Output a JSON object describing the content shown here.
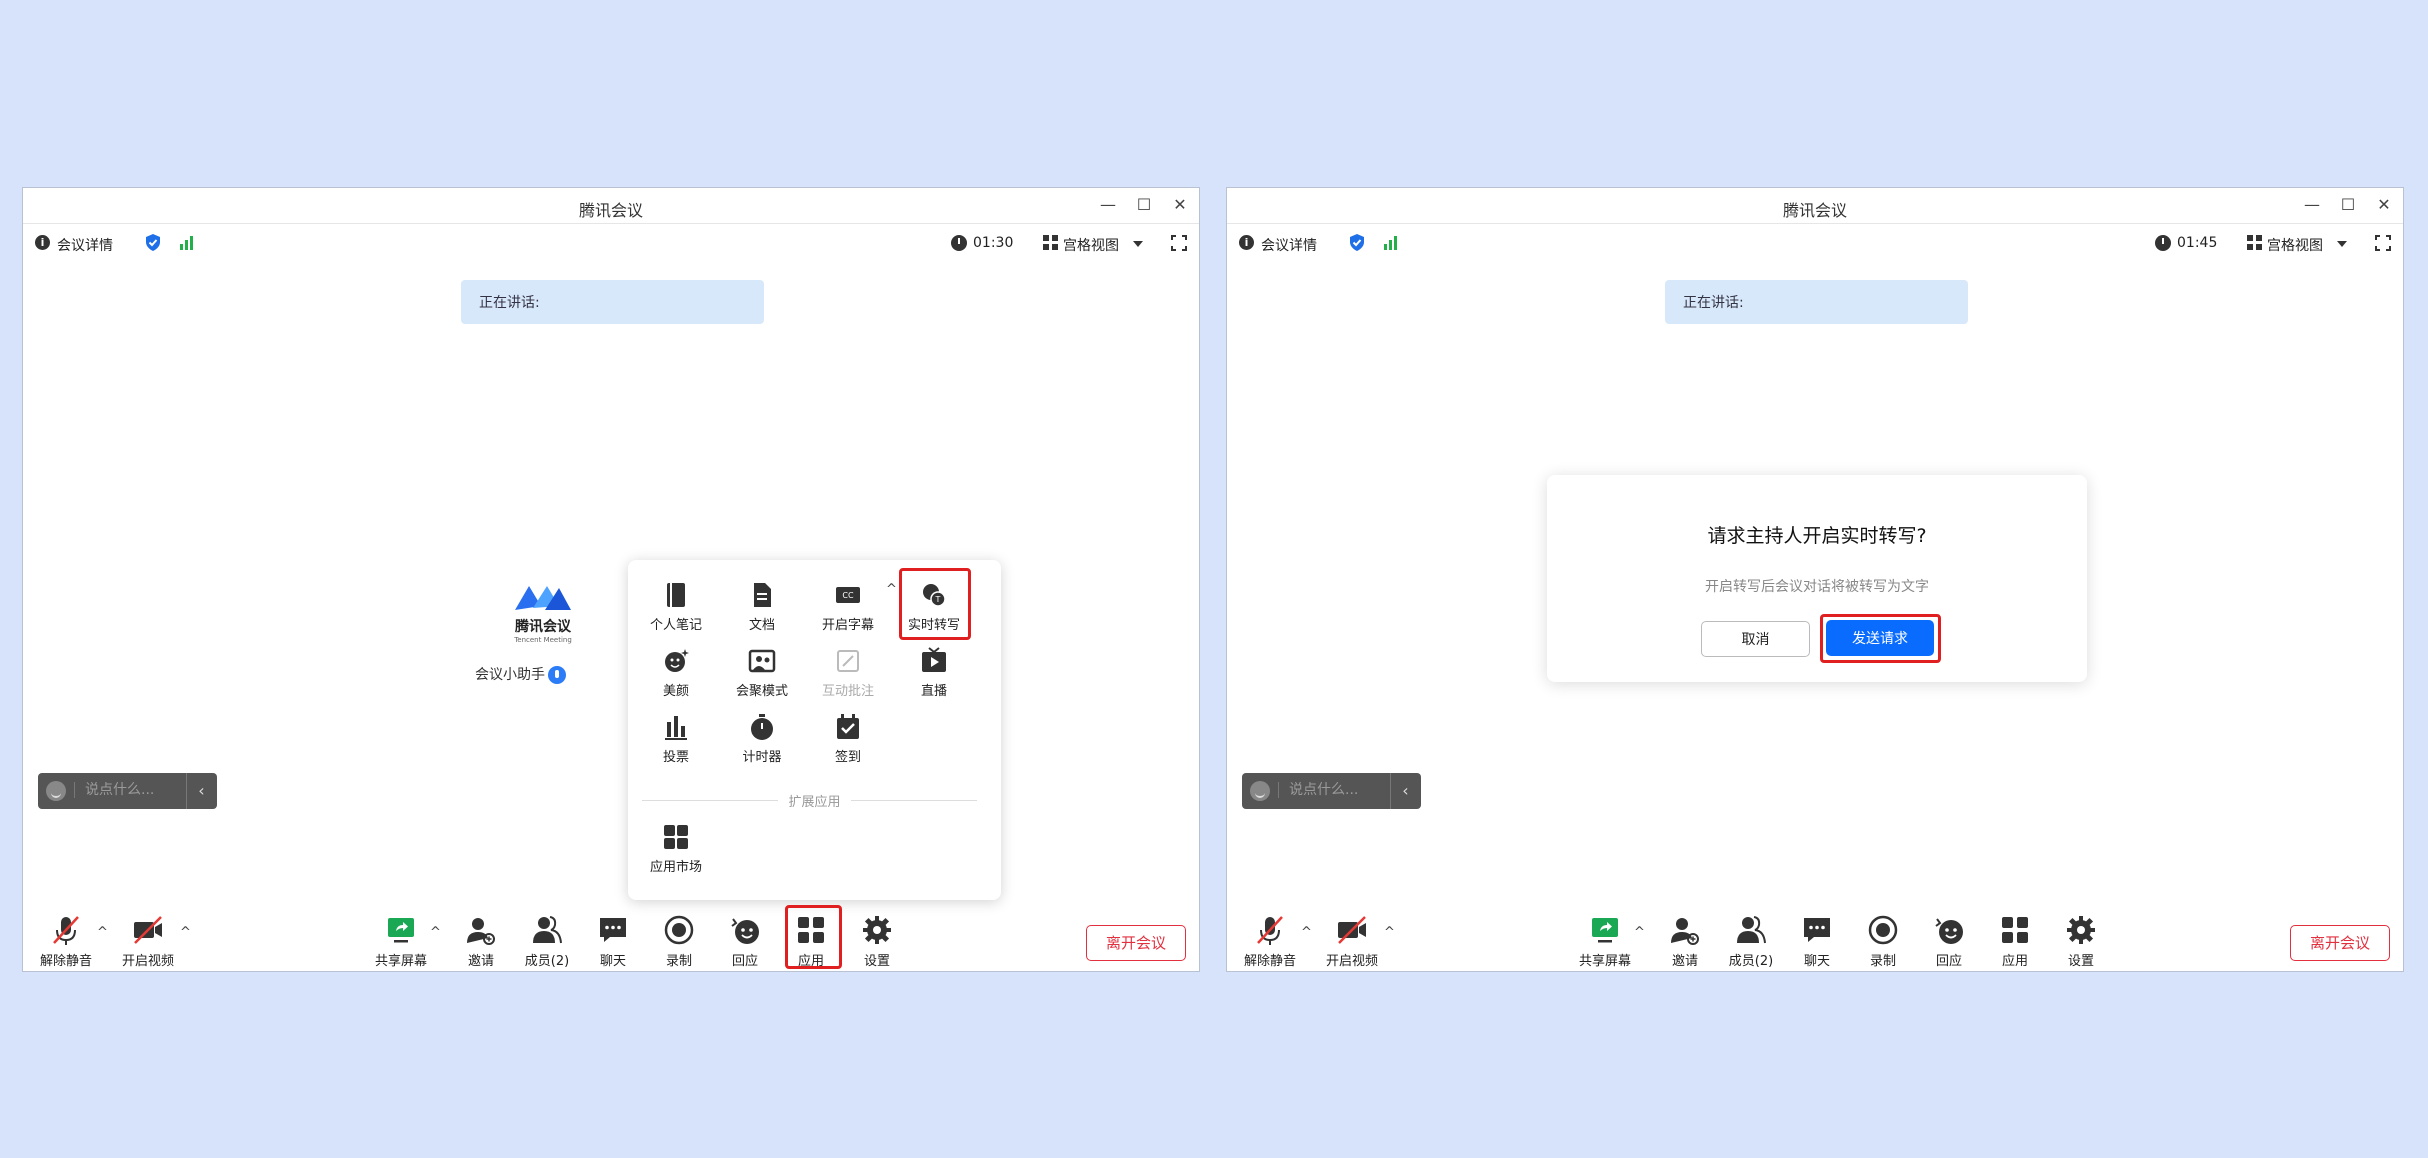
{
  "colors": {
    "accent": "#0a6cff",
    "danger": "#e2303f",
    "background": "#d6e3fb",
    "speaking_bg": "#d8e8fb",
    "signal": "#23b04a"
  },
  "windows": [
    {
      "title": "腾讯会议",
      "meeting_detail": "会议详情",
      "timer": "01:30",
      "view_label": "宫格视图",
      "speaking": "正在讲话:",
      "logo": {
        "cn": "腾讯会议",
        "en": "Tencent Meeting"
      },
      "assistant": "会议小助手",
      "chat_placeholder": "说点什么...",
      "toolbar": {
        "mute": "解除静音",
        "video": "开启视频",
        "share": "共享屏幕",
        "invite": "邀请",
        "members": "成员(2)",
        "chat": "聊天",
        "record": "录制",
        "reaction": "回应",
        "apps": "应用",
        "settings": "设置",
        "leave": "离开会议"
      },
      "apps_panel": {
        "items": [
          {
            "label": "个人笔记",
            "icon": "notebook-icon"
          },
          {
            "label": "文档",
            "icon": "document-icon"
          },
          {
            "label": "开启字幕",
            "icon": "caption-icon"
          },
          {
            "label": "实时转写",
            "icon": "transcribe-icon"
          },
          {
            "label": "美颜",
            "icon": "beauty-icon"
          },
          {
            "label": "会聚模式",
            "icon": "together-mode-icon"
          },
          {
            "label": "互动批注",
            "icon": "annotation-icon",
            "disabled": true
          },
          {
            "label": "直播",
            "icon": "live-icon"
          },
          {
            "label": "投票",
            "icon": "poll-icon"
          },
          {
            "label": "计时器",
            "icon": "timer-icon"
          },
          {
            "label": "签到",
            "icon": "checkin-icon"
          }
        ],
        "ext_title": "扩展应用",
        "ext_items": [
          {
            "label": "应用市场",
            "icon": "app-market-icon"
          }
        ]
      }
    },
    {
      "title": "腾讯会议",
      "meeting_detail": "会议详情",
      "timer": "01:45",
      "view_label": "宫格视图",
      "speaking": "正在讲话:",
      "chat_placeholder": "说点什么...",
      "toolbar": {
        "mute": "解除静音",
        "video": "开启视频",
        "share": "共享屏幕",
        "invite": "邀请",
        "members": "成员(2)",
        "chat": "聊天",
        "record": "录制",
        "reaction": "回应",
        "apps": "应用",
        "settings": "设置",
        "leave": "离开会议"
      },
      "dialog": {
        "title": "请求主持人开启实时转写?",
        "desc": "开启转写后会议对话将被转写为文字",
        "cancel": "取消",
        "send": "发送请求"
      }
    }
  ]
}
